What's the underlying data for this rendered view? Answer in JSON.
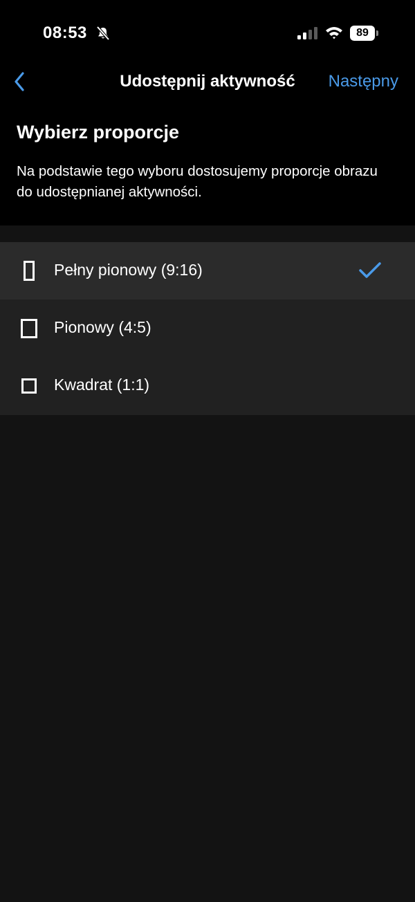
{
  "status_bar": {
    "time": "08:53",
    "battery": "89"
  },
  "nav": {
    "title": "Udostępnij aktywność",
    "next_label": "Następny"
  },
  "header": {
    "title": "Wybierz proporcje",
    "description": "Na podstawie tego wyboru dostosujemy proporcje obrazu do udostępnianej aktywności."
  },
  "options": [
    {
      "label": "Pełny pionowy (9:16)",
      "icon": "portrait-full-icon",
      "selected": true
    },
    {
      "label": "Pionowy (4:5)",
      "icon": "portrait-icon",
      "selected": false
    },
    {
      "label": "Kwadrat (1:1)",
      "icon": "square-icon",
      "selected": false
    }
  ],
  "colors": {
    "accent": "#4a9ae8",
    "background": "#131313",
    "header_background": "#000000",
    "list_background": "#212121",
    "selected_row": "#2b2b2b"
  }
}
